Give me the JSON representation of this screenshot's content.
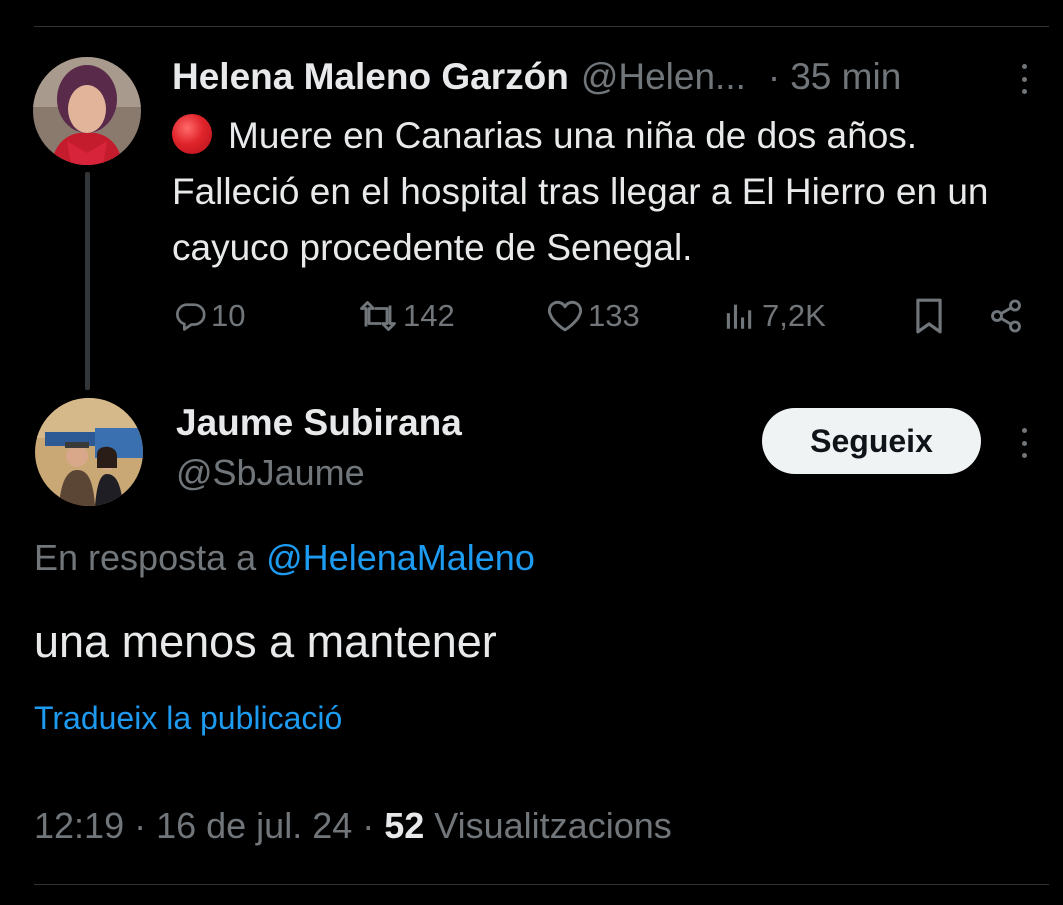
{
  "tweet1": {
    "author_name": "Helena Maleno Garzón",
    "handle": "@Helen...",
    "separator": "·",
    "time": "35 min",
    "status_icon": "red-circle-emoji",
    "text": "Muere en Canarias una niña de dos años. Falleció en el hospital tras llegar a El Hierro en un cayuco procedente de Senegal.",
    "actions": {
      "replies": "10",
      "reposts": "142",
      "likes": "133",
      "views": "7,2K"
    }
  },
  "tweet2": {
    "author_name": "Jaume Subirana",
    "handle": "@SbJaume",
    "follow_label": "Segueix",
    "reply_prefix": "En resposta a ",
    "reply_mention": "@HelenaMaleno",
    "text": "una menos a mantener",
    "translate_label": "Tradueix la publicació",
    "timestamp": "12:19 · 16 de jul. 24 · ",
    "views_count": "52",
    "views_label": " Visualitzacions"
  },
  "colors": {
    "background": "#000000",
    "primary_text": "#e7e9ea",
    "secondary_text": "#71767b",
    "link": "#1d9bf0",
    "button_bg": "#eff3f4"
  }
}
